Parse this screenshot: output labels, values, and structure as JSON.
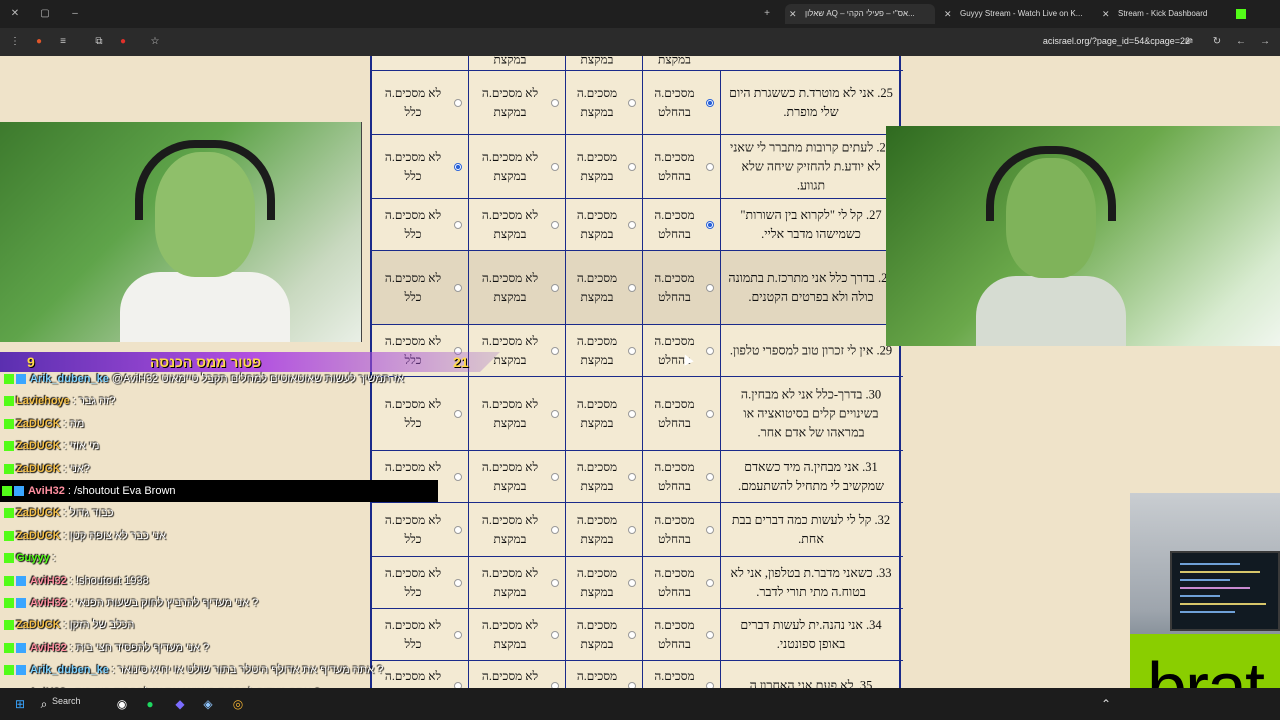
{
  "browser": {
    "tabs": [
      {
        "label": "שאלון AQ – אס\"י – פעילי הקהי...",
        "active": true
      },
      {
        "label": "Guyyy Stream - Watch Live on K...",
        "active": false
      },
      {
        "label": "Stream - Kick Dashboard",
        "active": false
      }
    ],
    "url": "acisrael.org/?page_id=54&cpage=22"
  },
  "questionnaire": {
    "options": [
      "מסכים.ה בהחלט",
      "מסכים.ה במקצת",
      "לא מסכים.ה במקצת",
      "לא מסכים.ה כלל"
    ],
    "partial_top": [
      "במקצת",
      "במקצת",
      "במקצת"
    ],
    "rows": [
      {
        "text": "25. אני לא מוטרד.ת כששגרת היום שלי מופרת.",
        "selected": 0
      },
      {
        "text": "26. לעתים קרובות מתברר לי שאני לא יודע.ת להחזיק שיחה שלא תגווע.",
        "selected": 3
      },
      {
        "text": "27. קל לי \"לקרוא בין השורות\" כשמישהו מדבר אליי.",
        "selected": 0
      },
      {
        "text": "28. בדרך כלל אני מתרכז.ת בתמונה כולה ולא בפרטים הקטנים.",
        "selected": -1
      },
      {
        "text": "29. אין לי זכרון טוב למספרי טלפון.",
        "selected": -1
      },
      {
        "text": "30. בדרך-כלל אני לא מבחין.ה בשינויים קלים בסיטואציה או במראהו של אדם אחר.",
        "selected": -1
      },
      {
        "text": "31. אני מבחין.ה מיד כשאדם שמקשיב לי מתחיל להשתעמם.",
        "selected": -1
      },
      {
        "text": "32. קל לי לעשות כמה דברים בבת אחת.",
        "selected": -1
      },
      {
        "text": "33. כשאני מדבר.ת בטלפון, אני לא בטוח.ה מתי תורי לדבר.",
        "selected": -1
      },
      {
        "text": "34. אני נהנה.ית לעשות דברים באופן ספונטני.",
        "selected": -1
      },
      {
        "text": "35. לא פעם אני האחרון.ה",
        "selected": -1
      }
    ]
  },
  "overlay": {
    "goal_text": "פטור ממס הכנסה",
    "goal_left": "9",
    "goal_right": "21",
    "chat": [
      {
        "user": "Arik_duben_ke",
        "msg": "@AviH32 אז תמשיך לעשות שאוטאוטים למחלים תקבל טיימאוט",
        "color": "#7fd3ff"
      },
      {
        "user": "Laviehoye",
        "msg": ": זה גבר?",
        "color": "#f7c24a"
      },
      {
        "user": "ZaDUCK",
        "msg": ": מה",
        "color": "#f7c24a"
      },
      {
        "user": "ZaDUCK",
        "msg": ": מי אוזי",
        "color": "#f7c24a"
      },
      {
        "user": "ZaDUCK",
        "msg": ": אני?",
        "color": "#f7c24a"
      },
      {
        "user": "AviH32",
        "msg": ": /shoutout Eva Brown",
        "color": "#ff8fa0"
      },
      {
        "user": "ZaDUCK",
        "msg": ": כבוד גדול",
        "color": "#f7c24a"
      },
      {
        "user": "ZaDUCK",
        "msg": ": אני כבר לא צופה קטן",
        "color": "#f7c24a"
      },
      {
        "user": "Guyyy",
        "msg": ":",
        "color": "#53fc18"
      },
      {
        "user": "AviH32",
        "msg": ": !shoutout 1938",
        "color": "#ff8fa0"
      },
      {
        "user": "AviH32",
        "msg": ": אני מעדיף להרביץ לחוק בשעות הפנאי ?",
        "color": "#ff8fa0"
      },
      {
        "user": "ZaDUCK",
        "msg": ": הכלב של הזקן",
        "color": "#f7c24a"
      },
      {
        "user": "AviH32",
        "msg": ": אני מעדיף להפסיד חצי בית ?",
        "color": "#ff8fa0"
      },
      {
        "user": "Arik_duben_ke",
        "msg": ": אתה מעדיף את אדולף היטלר בתור שולט או יחיא סינואר ?",
        "color": "#7fd3ff"
      },
      {
        "user": "AviH32",
        "msg": ": אתה מעדיף להפסיד באמונג אס או להפסיד חצי בית ?",
        "color": "#ff8fa0"
      }
    ],
    "brat": "brat"
  },
  "taskbar": {
    "search_label": "Search"
  }
}
